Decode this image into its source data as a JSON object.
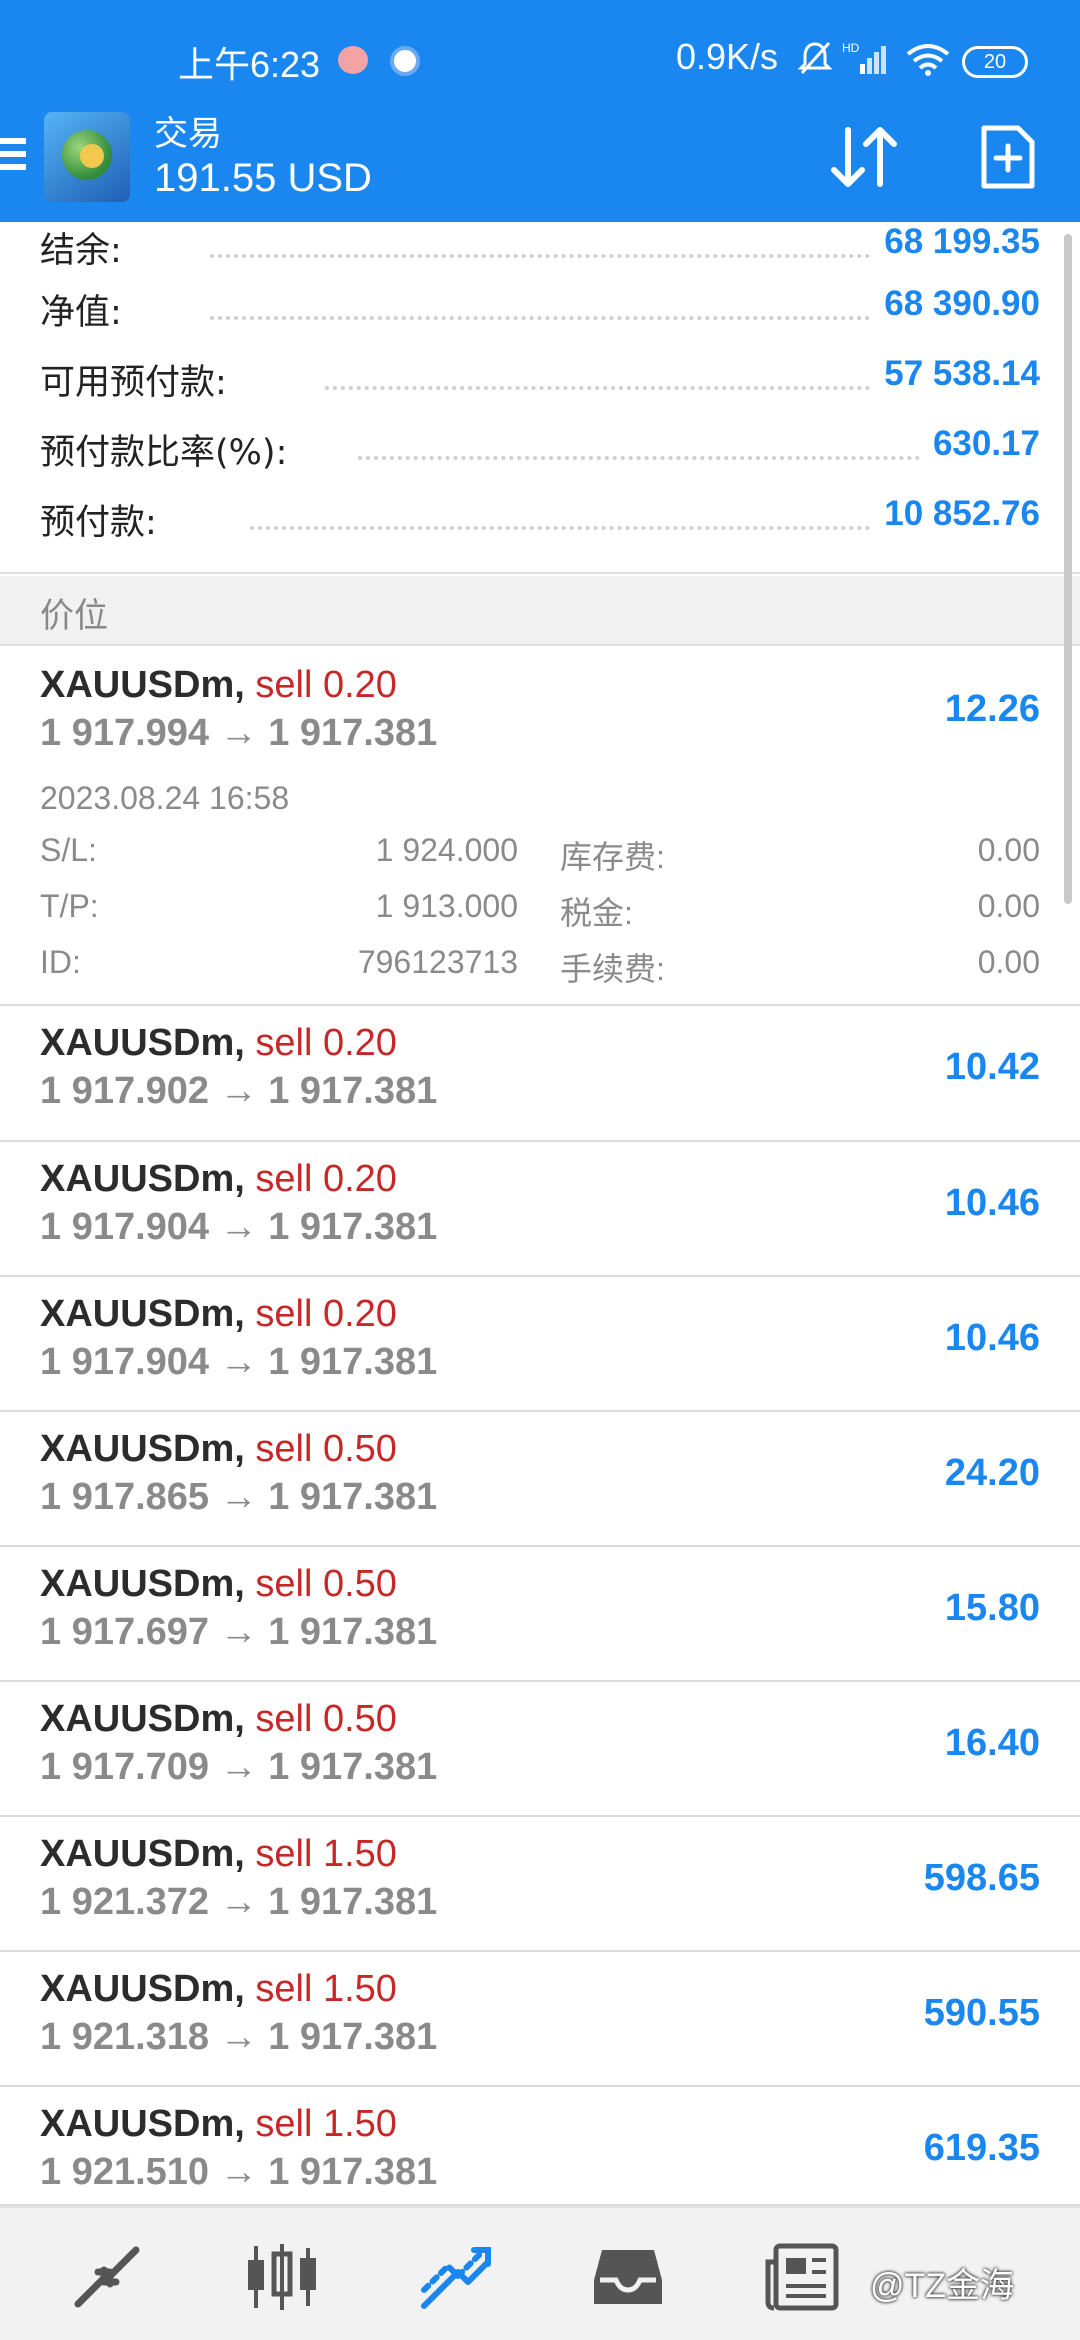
{
  "status_bar": {
    "time": "上午6:23",
    "net_speed": "0.9K/s",
    "battery": "20",
    "hd_label": "HD"
  },
  "app_bar": {
    "title": "交易",
    "balance": "191.55 USD"
  },
  "summary": [
    {
      "label": "结余:",
      "value": "68 199.35"
    },
    {
      "label": "净值:",
      "value": "68 390.90"
    },
    {
      "label": "可用预付款:",
      "value": "57 538.14"
    },
    {
      "label": "预付款比率(%):",
      "value": "630.17"
    },
    {
      "label": "预付款:",
      "value": "10 852.76"
    }
  ],
  "section_title": "价位",
  "positions": [
    {
      "symbol": "XAUUSDm,",
      "side": "sell 0.20",
      "open": "1 917.994",
      "arrow": "→",
      "current": "1 917.381",
      "profit": "12.26",
      "expanded": true,
      "time": "2023.08.24 16:58",
      "details": [
        {
          "k1": "S/L:",
          "v1": "1 924.000",
          "k2": "库存费:",
          "v2": "0.00"
        },
        {
          "k1": "T/P:",
          "v1": "1 913.000",
          "k2": "税金:",
          "v2": "0.00"
        },
        {
          "k1": "ID:",
          "v1": "796123713",
          "k2": "手续费:",
          "v2": "0.00"
        }
      ]
    },
    {
      "symbol": "XAUUSDm,",
      "side": "sell 0.20",
      "open": "1 917.902",
      "arrow": "→",
      "current": "1 917.381",
      "profit": "10.42"
    },
    {
      "symbol": "XAUUSDm,",
      "side": "sell 0.20",
      "open": "1 917.904",
      "arrow": "→",
      "current": "1 917.381",
      "profit": "10.46"
    },
    {
      "symbol": "XAUUSDm,",
      "side": "sell 0.20",
      "open": "1 917.904",
      "arrow": "→",
      "current": "1 917.381",
      "profit": "10.46"
    },
    {
      "symbol": "XAUUSDm,",
      "side": "sell 0.50",
      "open": "1 917.865",
      "arrow": "→",
      "current": "1 917.381",
      "profit": "24.20"
    },
    {
      "symbol": "XAUUSDm,",
      "side": "sell 0.50",
      "open": "1 917.697",
      "arrow": "→",
      "current": "1 917.381",
      "profit": "15.80"
    },
    {
      "symbol": "XAUUSDm,",
      "side": "sell 0.50",
      "open": "1 917.709",
      "arrow": "→",
      "current": "1 917.381",
      "profit": "16.40"
    },
    {
      "symbol": "XAUUSDm,",
      "side": "sell 1.50",
      "open": "1 921.372",
      "arrow": "→",
      "current": "1 917.381",
      "profit": "598.65"
    },
    {
      "symbol": "XAUUSDm,",
      "side": "sell 1.50",
      "open": "1 921.318",
      "arrow": "→",
      "current": "1 917.381",
      "profit": "590.55"
    },
    {
      "symbol": "XAUUSDm,",
      "side": "sell 1.50",
      "open": "1 921.510",
      "arrow": "→",
      "current": "1 917.381",
      "profit": "619.35"
    }
  ],
  "bottom_nav": [
    {
      "name": "quotes-icon",
      "active": false
    },
    {
      "name": "chart-icon",
      "active": false
    },
    {
      "name": "trade-icon",
      "active": true
    },
    {
      "name": "history-icon",
      "active": false
    },
    {
      "name": "news-icon",
      "active": false
    }
  ],
  "watermark": "@TZ金海",
  "colors": {
    "primary": "#1a86f0",
    "sell": "#c62828",
    "muted": "#8a8a8a"
  }
}
